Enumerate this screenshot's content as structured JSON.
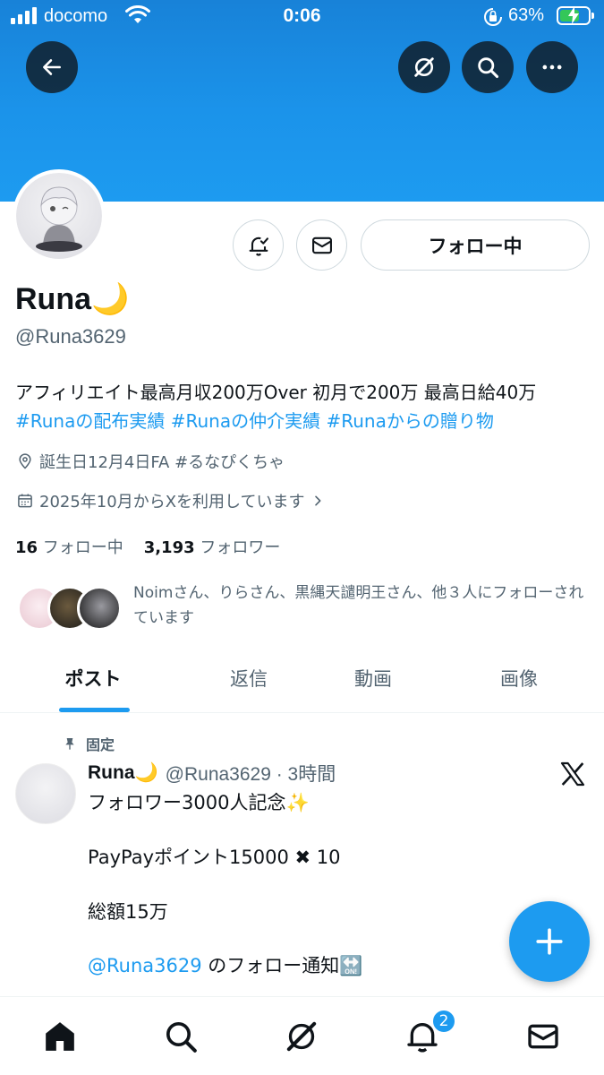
{
  "status_bar": {
    "carrier": "docomo",
    "time": "0:06",
    "battery": "63%",
    "battery_level": 0.63
  },
  "profile": {
    "name": "Runa🌙",
    "handle": "@Runa3629",
    "follow_button": "フォロー中",
    "bio_text": "アフィリエイト最高月収200万Over 初月で200万 最高日給40万",
    "bio_tags": [
      "#Runaの配布実績",
      "#Runaの仲介実績",
      "#Runaからの贈り物"
    ],
    "location": "誕生日12月4日FA #るなぴくちゃ",
    "joined": "2025年10月からXを利用しています",
    "following_count": "16",
    "following_label": "フォロー中",
    "followers_count": "3,193",
    "followers_label": "フォロワー",
    "followed_by_text": "Noimさん、りらさん、黒縄天譴明王さん、他３人にフォローされています"
  },
  "tabs": [
    "ポスト",
    "返信",
    "動画",
    "画像"
  ],
  "pinned_post": {
    "pinned_label": "固定",
    "author_name": "Runa🌙",
    "meta": "@Runa3629 · 3時間",
    "line1": "フォロワー3000人記念✨",
    "line2": "PayPayポイント15000 ✖ 10",
    "line3": "総額15万",
    "mention": "@Runa3629",
    "line4_suffix": " のフォロー通知🔛"
  },
  "nav_badge": "2",
  "colors": {
    "accent": "#1d9bf0",
    "text": "#0f1419",
    "muted": "#536471"
  }
}
